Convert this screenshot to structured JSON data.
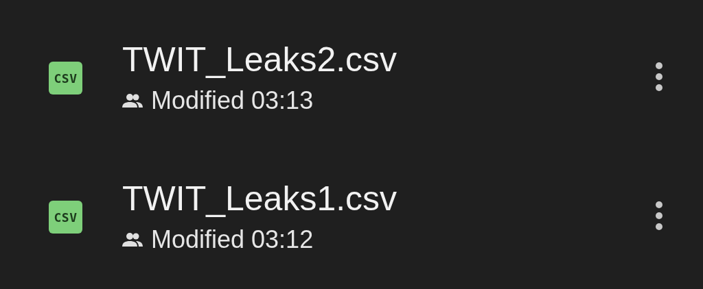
{
  "files": [
    {
      "badge": "CSV",
      "name": "TWIT_Leaks2.csv",
      "modified": "Modified 03:13"
    },
    {
      "badge": "CSV",
      "name": "TWIT_Leaks1.csv",
      "modified": "Modified 03:12"
    }
  ]
}
